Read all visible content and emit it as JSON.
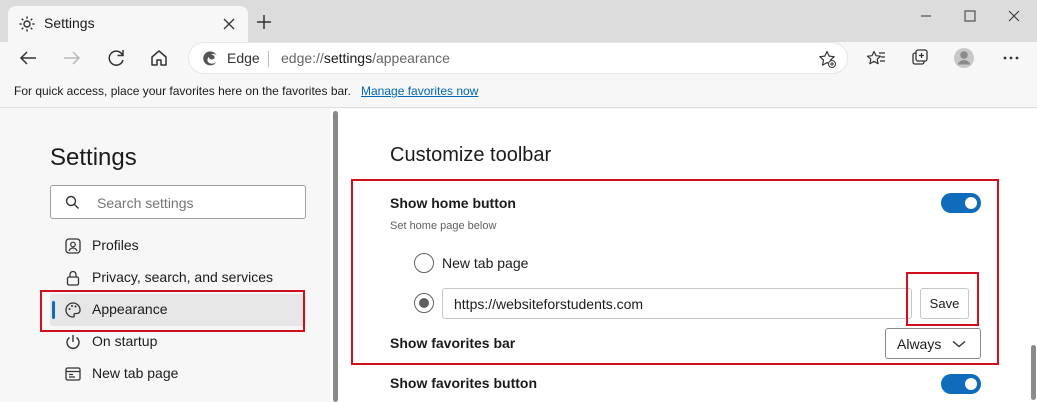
{
  "tab": {
    "title": "Settings"
  },
  "address_bar": {
    "brand": "Edge",
    "url_scheme": "edge://",
    "url_path": "settings",
    "url_rest": "/appearance"
  },
  "favorites_bar": {
    "message": "For quick access, place your favorites here on the favorites bar.",
    "link": "Manage favorites now"
  },
  "sidebar": {
    "title": "Settings",
    "search_placeholder": "Search settings",
    "items": [
      {
        "label": "Profiles",
        "icon": "profile-icon"
      },
      {
        "label": "Privacy, search, and services",
        "icon": "lock-icon"
      },
      {
        "label": "Appearance",
        "icon": "palette-icon",
        "active": true
      },
      {
        "label": "On startup",
        "icon": "power-icon"
      },
      {
        "label": "New tab page",
        "icon": "new-tab-icon"
      }
    ]
  },
  "main": {
    "section_title": "Customize toolbar",
    "home_button": {
      "label": "Show home button",
      "sublabel": "Set home page below",
      "enabled": true,
      "option_new_tab": "New tab page",
      "url_value": "https://websiteforstudents.com",
      "save_label": "Save"
    },
    "favorites_bar": {
      "label": "Show favorites bar",
      "value": "Always"
    },
    "favorites_button": {
      "label": "Show favorites button",
      "enabled": true
    }
  },
  "colors": {
    "accent": "#0f6cbd",
    "highlight": "#d20f1c"
  }
}
